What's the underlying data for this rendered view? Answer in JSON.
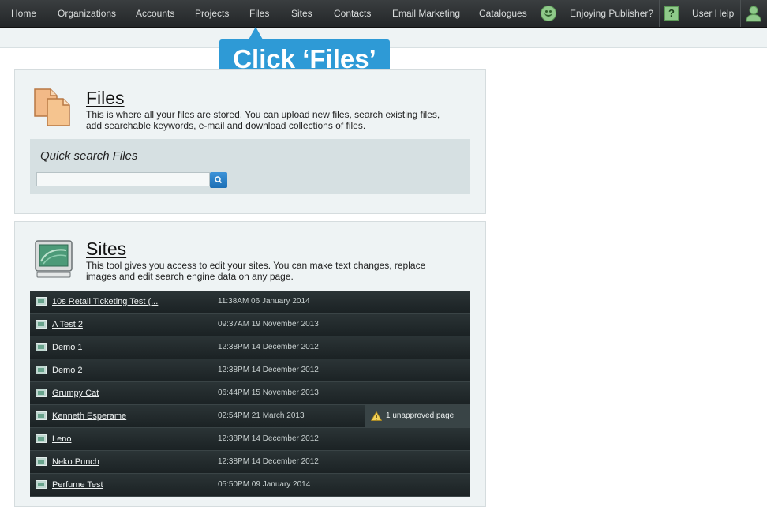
{
  "nav": {
    "items": [
      "Home",
      "Organizations",
      "Accounts",
      "Projects",
      "Files",
      "Sites",
      "Contacts",
      "Email Marketing",
      "Catalogues"
    ],
    "enjoying": "Enjoying Publisher?",
    "help_glyph": "?",
    "user_help": "User Help",
    "icons": [
      "smiley-icon",
      "help-icon",
      "user-icon"
    ]
  },
  "callout": {
    "text": "Click ‘Files’"
  },
  "files_panel": {
    "title": "Files",
    "description": "This is where all your files are stored. You can upload new files, search existing files, add searchable keywords, e-mail and download collections of files.",
    "search_heading": "Quick search Files",
    "search_value": "",
    "icon": "files-icon"
  },
  "sites_panel": {
    "title": "Sites",
    "description": "This tool gives you access to edit your sites. You can make text changes, replace images and edit search engine data on any page.",
    "icon": "monitor-icon",
    "rows": [
      {
        "name": "10s Retail Ticketing Test (...",
        "time": "11:38AM 06 January 2014",
        "warning": ""
      },
      {
        "name": "A Test 2",
        "time": "09:37AM 19 November 2013",
        "warning": ""
      },
      {
        "name": "Demo 1",
        "time": "12:38PM 14 December 2012",
        "warning": ""
      },
      {
        "name": "Demo 2",
        "time": "12:38PM 14 December 2012",
        "warning": ""
      },
      {
        "name": "Grumpy Cat",
        "time": "06:44PM 15 November 2013",
        "warning": ""
      },
      {
        "name": "Kenneth Esperame",
        "time": "02:54PM 21 March 2013",
        "warning": "1 unapproved page"
      },
      {
        "name": "Leno",
        "time": "12:38PM 14 December 2012",
        "warning": ""
      },
      {
        "name": "Neko Punch",
        "time": "12:38PM 14 December 2012",
        "warning": ""
      },
      {
        "name": "Perfume Test",
        "time": "05:50PM 09 January 2014",
        "warning": ""
      }
    ]
  },
  "colors": {
    "accent": "#2e9ad6",
    "topbar": "#2d3133",
    "panel": "#eef3f4",
    "row": "#232b2d"
  }
}
